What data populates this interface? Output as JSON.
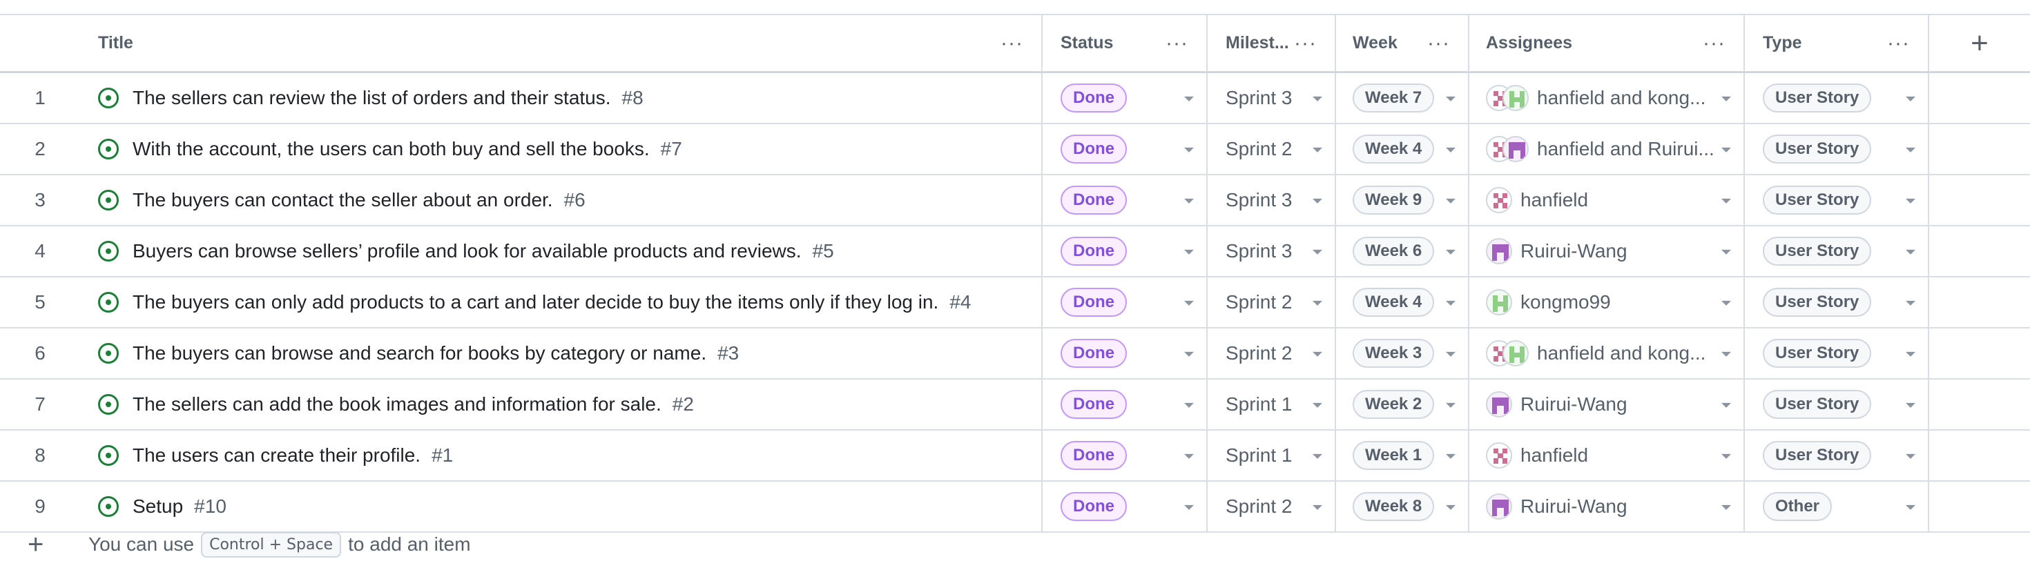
{
  "header": {
    "title": "Title",
    "status": "Status",
    "milestone": "Milest...",
    "week": "Week",
    "assignees": "Assignees",
    "type": "Type",
    "dots": "···",
    "add": "+"
  },
  "rows": [
    {
      "num": "1",
      "title": "The sellers can review the list of orders and their status.",
      "issue": "#8",
      "status": "Done",
      "milestone": "Sprint 3",
      "week": "Week 7",
      "assignees": "hanfield and kong...",
      "avatars": [
        "hanfield",
        "kongmo99"
      ],
      "type": "User Story"
    },
    {
      "num": "2",
      "title": "With the account, the users can both buy and sell the books.",
      "issue": "#7",
      "status": "Done",
      "milestone": "Sprint 2",
      "week": "Week 4",
      "assignees": "hanfield and Ruirui...",
      "avatars": [
        "hanfield",
        "Ruirui-Wang"
      ],
      "type": "User Story"
    },
    {
      "num": "3",
      "title": "The buyers can contact the seller about an order.",
      "issue": "#6",
      "status": "Done",
      "milestone": "Sprint 3",
      "week": "Week 9",
      "assignees": "hanfield",
      "avatars": [
        "hanfield"
      ],
      "type": "User Story"
    },
    {
      "num": "4",
      "title": "Buyers can browse sellers’ profile and look for available products and reviews.",
      "issue": "#5",
      "status": "Done",
      "milestone": "Sprint 3",
      "week": "Week 6",
      "assignees": "Ruirui-Wang",
      "avatars": [
        "Ruirui-Wang"
      ],
      "type": "User Story"
    },
    {
      "num": "5",
      "title": "The buyers can only add products to a cart and later decide to buy the items only if they log in.",
      "issue": "#4",
      "status": "Done",
      "milestone": "Sprint 2",
      "week": "Week 4",
      "assignees": "kongmo99",
      "avatars": [
        "kongmo99"
      ],
      "type": "User Story"
    },
    {
      "num": "6",
      "title": "The buyers can browse and search for books by category or name.",
      "issue": "#3",
      "status": "Done",
      "milestone": "Sprint 2",
      "week": "Week 3",
      "assignees": "hanfield and kong...",
      "avatars": [
        "hanfield",
        "kongmo99"
      ],
      "type": "User Story"
    },
    {
      "num": "7",
      "title": "The sellers can add the book images and information for sale.",
      "issue": "#2",
      "status": "Done",
      "milestone": "Sprint 1",
      "week": "Week 2",
      "assignees": "Ruirui-Wang",
      "avatars": [
        "Ruirui-Wang"
      ],
      "type": "User Story"
    },
    {
      "num": "8",
      "title": "The users can create their profile.",
      "issue": "#1",
      "status": "Done",
      "milestone": "Sprint 1",
      "week": "Week 1",
      "assignees": "hanfield",
      "avatars": [
        "hanfield"
      ],
      "type": "User Story"
    },
    {
      "num": "9",
      "title": "Setup",
      "issue": "#10",
      "status": "Done",
      "milestone": "Sprint 2",
      "week": "Week 8",
      "assignees": "Ruirui-Wang",
      "avatars": [
        "Ruirui-Wang"
      ],
      "type": "Other"
    }
  ],
  "footer": {
    "add": "+",
    "prefix": "You can use",
    "shortcut": "Control + Space",
    "suffix": "to add an item"
  },
  "icons": {
    "issue": "issue-open-icon",
    "caret": "chevron-down-icon",
    "plus": "plus-icon",
    "more": "kebab-horizontal-icon"
  },
  "colors": {
    "done_badge": "#8250df",
    "issue_open": "#1a7f37",
    "border": "#d8dee4"
  }
}
